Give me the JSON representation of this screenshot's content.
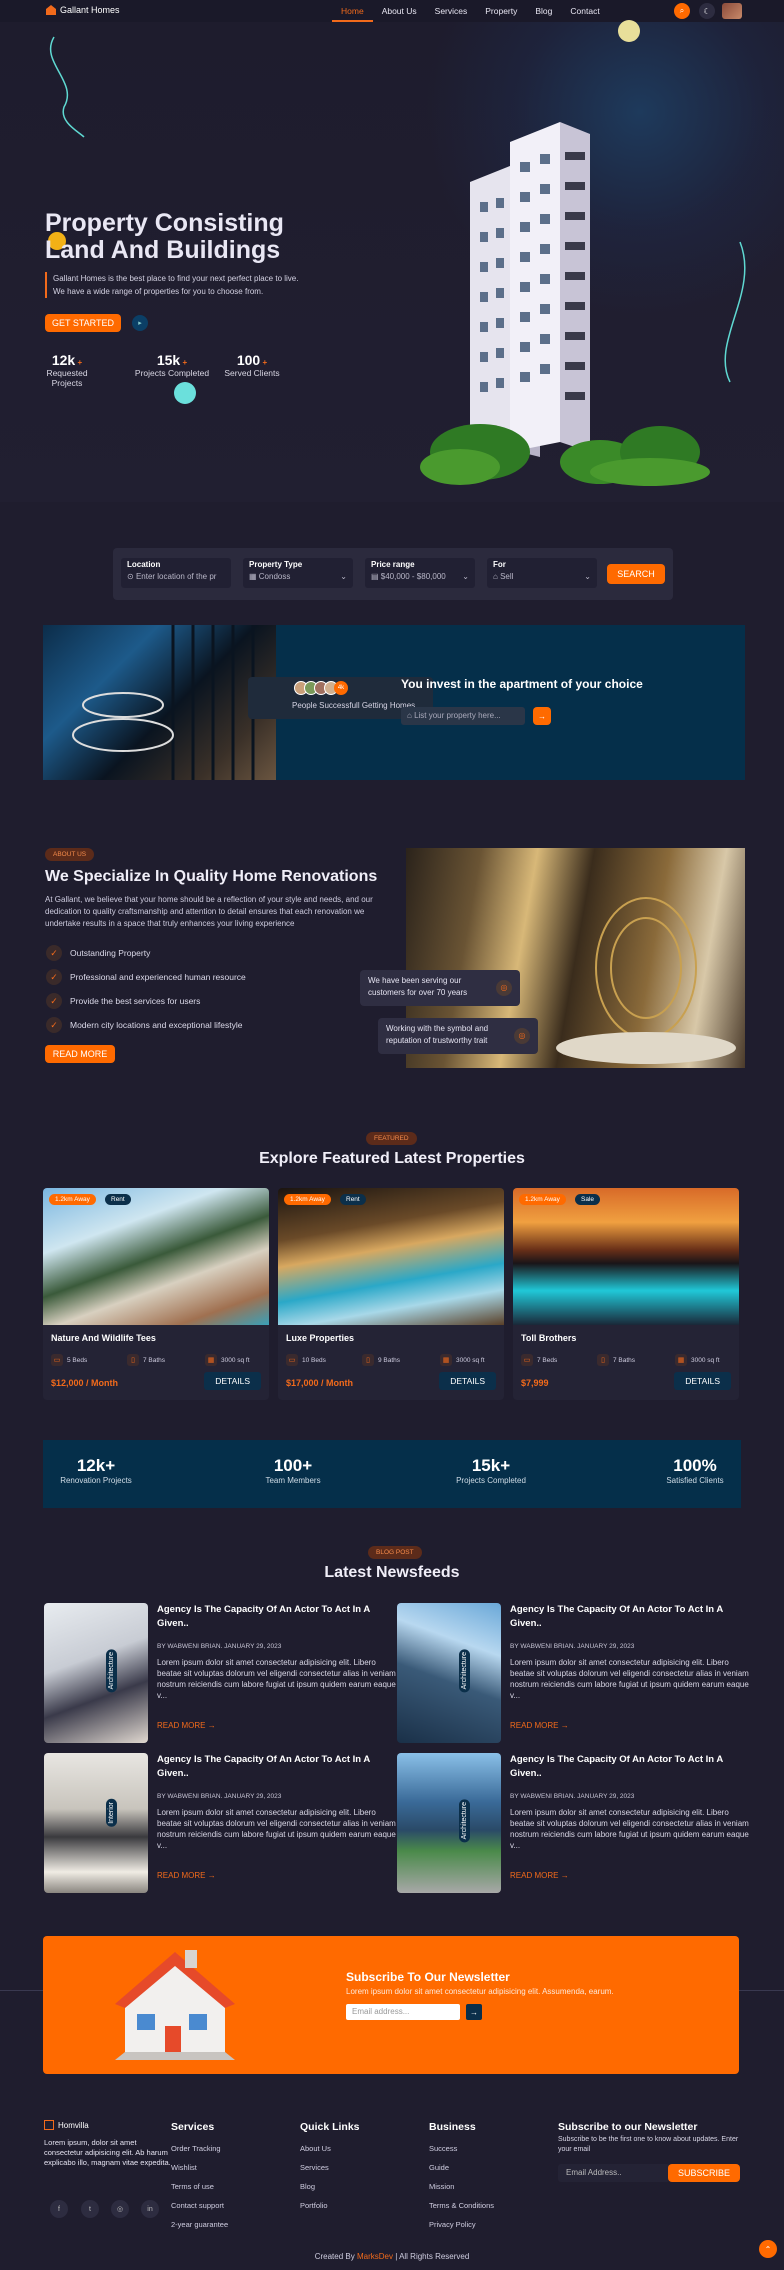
{
  "nav": {
    "brand": "Gallant Homes",
    "items": [
      "Home",
      "About Us",
      "Services",
      "Property",
      "Blog",
      "Contact"
    ]
  },
  "hero": {
    "title_line1": "Property Consisting",
    "title_line2": "Land And Buildings",
    "desc_line1": "Gallant Homes is the best place to find your next perfect place to live.",
    "desc_line2": "We have a wide range of properties for you to choose from.",
    "cta": "GET STARTED",
    "stats": [
      {
        "num": "12k",
        "label": "Requested Projects"
      },
      {
        "num": "15k",
        "label": "Projects Completed"
      },
      {
        "num": "100",
        "label": "Served Clients"
      }
    ]
  },
  "search": {
    "location_label": "Location",
    "location_placeholder": "Enter location of the pr",
    "type_label": "Property Type",
    "type_value": "Condoss",
    "price_label": "Price range",
    "price_value": "$40,000 - $80,000",
    "for_label": "For",
    "for_value": "Sell",
    "button": "SEARCH"
  },
  "invest": {
    "avatars_count": "4k",
    "avatars_caption": "People Successfull Getting Homes",
    "title": "You invest in the apartment of your choice",
    "input_placeholder": "List your property here..."
  },
  "about": {
    "tag": "ABOUT US",
    "title": "We Specialize In Quality Home Renovations",
    "desc": "At Gallant, we believe that your home should be a reflection of your style and needs, and our dedication to quality craftsmanship and attention to detail ensures that each renovation we undertake results in a space that truly enhances your living experience",
    "checks": [
      "Outstanding Property",
      "Professional and experienced human resource",
      "Provide the best services for users",
      "Modern city locations and exceptional lifestyle"
    ],
    "button": "READ MORE",
    "bubble1": "We have been serving our customers for over 70 years",
    "bubble2": "Working with the symbol and reputation of trustworthy trait"
  },
  "featured": {
    "tag": "FEATURED",
    "title": "Explore Featured Latest Properties",
    "cards": [
      {
        "away": "1.2km Away",
        "kind": "Rent",
        "title": "Nature And Wildlife Tees",
        "beds": "5 Beds",
        "baths": "7 Baths",
        "area": "3000 sq ft",
        "price": "$12,000 / Month",
        "details": "DETAILS"
      },
      {
        "away": "1.2km Away",
        "kind": "Rent",
        "title": "Luxe Properties",
        "beds": "10 Beds",
        "baths": "9 Baths",
        "area": "3000 sq ft",
        "price": "$17,000 / Month",
        "details": "DETAILS"
      },
      {
        "away": "1.2km Away",
        "kind": "Sale",
        "title": "Toll Brothers",
        "beds": "7 Beds",
        "baths": "7 Baths",
        "area": "3000 sq ft",
        "price": "$7,999",
        "details": "DETAILS"
      }
    ]
  },
  "stats": [
    {
      "num": "12k+",
      "label": "Renovation Projects"
    },
    {
      "num": "100+",
      "label": "Team Members"
    },
    {
      "num": "15k+",
      "label": "Projects Completed"
    },
    {
      "num": "100%",
      "label": "Satisfied Clients"
    }
  ],
  "blog": {
    "tag": "BLOG POST",
    "title": "Latest Newsfeeds",
    "posts": [
      {
        "title": "Agency Is The Capacity Of An Actor To Act In A Given..",
        "by": "BY WABWENI BRIAN. JANUARY 29, 2023",
        "excerpt": "Lorem ipsum dolor sit amet consectetur adipisicing elit. Libero beatae sit voluptas dolorum vel eligendi consectetur alias in veniam nostrum reiciendis cum labore fugiat ut ipsum quidem earum eaque v...",
        "more": "READ MORE",
        "cat": "Architecture"
      },
      {
        "title": "Agency Is The Capacity Of An Actor To Act In A Given..",
        "by": "BY WABWENI BRIAN. JANUARY 29, 2023",
        "excerpt": "Lorem ipsum dolor sit amet consectetur adipisicing elit. Libero beatae sit voluptas dolorum vel eligendi consectetur alias in veniam nostrum reiciendis cum labore fugiat ut ipsum quidem earum eaque v...",
        "more": "READ MORE",
        "cat": "Architecture"
      },
      {
        "title": "Agency Is The Capacity Of An Actor To Act In A Given..",
        "by": "BY WABWENI BRIAN. JANUARY 29, 2023",
        "excerpt": "Lorem ipsum dolor sit amet consectetur adipisicing elit. Libero beatae sit voluptas dolorum vel eligendi consectetur alias in veniam nostrum reiciendis cum labore fugiat ut ipsum quidem earum eaque v...",
        "more": "READ MORE",
        "cat": "Interior"
      },
      {
        "title": "Agency Is The Capacity Of An Actor To Act In A Given..",
        "by": "BY WABWENI BRIAN. JANUARY 29, 2023",
        "excerpt": "Lorem ipsum dolor sit amet consectetur adipisicing elit. Libero beatae sit voluptas dolorum vel eligendi consectetur alias in veniam nostrum reiciendis cum labore fugiat ut ipsum quidem earum eaque v...",
        "more": "READ MORE",
        "cat": "Architecture"
      }
    ]
  },
  "newsletter": {
    "title": "Subscribe To Our Newsletter",
    "desc": "Lorem ipsum dolor sit amet consectetur adipisicing elit. Assumenda, earum.",
    "placeholder": "Email address..."
  },
  "footer": {
    "brand": "Homvilla",
    "about": "Lorem ipsum, dolor sit amet consectetur adipisicing elit. Ab harum explicabo illo, magnam vitae expedita.",
    "services_title": "Services",
    "services": [
      "Order Tracking",
      "Wishlist",
      "Terms of use",
      "Contact support",
      "2-year guarantee"
    ],
    "quick_title": "Quick Links",
    "quick": [
      "About Us",
      "Services",
      "Blog",
      "Portfolio"
    ],
    "business_title": "Business",
    "business": [
      "Success",
      "Guide",
      "Mission",
      "Terms & Conditions",
      "Privacy Policy"
    ],
    "nl_title": "Subscribe to our Newsletter",
    "nl_desc": "Subscribe to be the first one to know about updates. Enter your email",
    "nl_placeholder": "Email Address..",
    "nl_button": "SUBSCRIBE",
    "credit_pre": "Created By",
    "credit_name": "MarksDev",
    "credit_post": "| All Rights Reserved"
  },
  "colors": {
    "accent": "#ff6a00",
    "navy": "#052f4a",
    "bg": "#1f1d2e"
  }
}
